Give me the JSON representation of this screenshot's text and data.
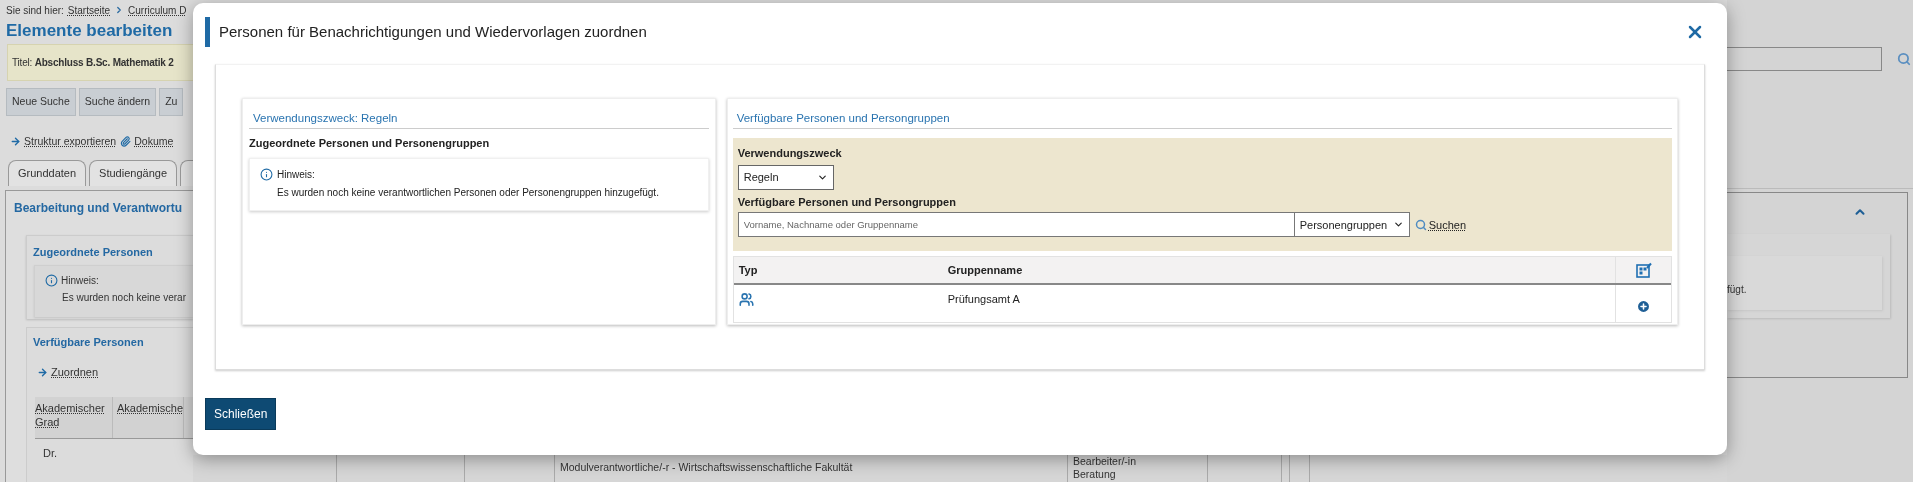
{
  "background_page": {
    "breadcrumb": {
      "label": "Sie sind hier:",
      "links": [
        "Startseite",
        "Curriculum D"
      ]
    },
    "title": "Elemente bearbeiten",
    "info_bar": "Titel: **Abschluss B.Sc. Mathematik 2**",
    "buttons": [
      "Neue Suche",
      "Suche ändern",
      "Zu"
    ],
    "actions": [
      {
        "kind": "arrow",
        "label": "Struktur exportieren"
      },
      {
        "kind": "attachment",
        "label": "Dokume"
      }
    ],
    "tabs": [
      "Grunddaten",
      "Studiengänge"
    ],
    "panel": {
      "heading": "Bearbeitung und Verantwortu",
      "assigned": {
        "heading": "Zugeordnete Personen",
        "hint_label": "Hinweis:",
        "hint_text": "Es wurden noch keine verar",
        "hint_text_end": "fügt."
      },
      "available": {
        "heading": "Verfügbare Personen",
        "action": "Zuordnen",
        "columns": [
          "Akademischer Grad",
          "Akademische"
        ],
        "rows": [
          [
            "Dr."
          ]
        ]
      }
    },
    "lower_table": {
      "responsibility": "Modulverantwortliche/-r - Wirtschaftswissenschaftliche Fakultät",
      "roles": [
        "Bearbeiter/-in",
        "Beratung"
      ]
    }
  },
  "dialog": {
    "title": "Personen für Benachrichtigungen und Wiedervorlagen zuordnen",
    "assigned_panel": {
      "heading": "Verwendungszweck: Regeln",
      "subheading": "Zugeordnete Personen und Personengruppen",
      "hint_label": "Hinweis:",
      "hint_text": "Es wurden noch keine verantwortlichen Personen oder Personengruppen hinzugefügt."
    },
    "available_panel": {
      "heading": "Verfügbare Personen und Persongruppen",
      "purpose_label": "Verwendungszweck",
      "purpose_select": {
        "value": "Regeln"
      },
      "search_label": "Verfügbare Personen und Persongruppen",
      "search_field": {
        "placeholder": "Vorname, Nachname oder Gruppenname"
      },
      "type_select": {
        "value": "Personengruppen"
      },
      "search_link": "Suchen",
      "table": {
        "columns": [
          "Typ",
          "Gruppenname"
        ],
        "rows": [
          {
            "kind": "group",
            "name": "Prüfungsamt A"
          }
        ]
      }
    },
    "close_button": "Schließen"
  }
}
